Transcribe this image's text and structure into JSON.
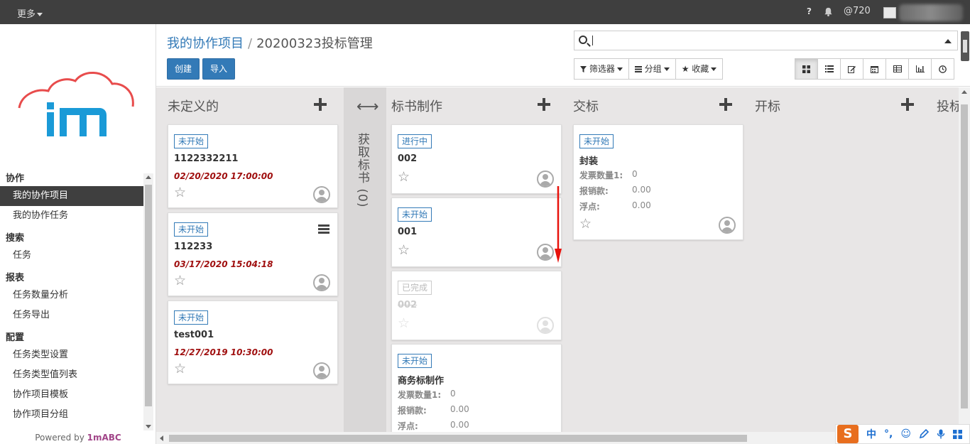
{
  "topbar": {
    "more": "更多",
    "help": "?",
    "at": "@720"
  },
  "sidebar": {
    "sections": [
      {
        "title": "协作",
        "items": [
          {
            "label": "我的协作项目",
            "active": true
          },
          {
            "label": "我的协作任务"
          }
        ]
      },
      {
        "title": "搜索",
        "items": [
          {
            "label": "任务"
          }
        ]
      },
      {
        "title": "报表",
        "items": [
          {
            "label": "任务数量分析"
          },
          {
            "label": "任务导出"
          }
        ]
      },
      {
        "title": "配置",
        "items": [
          {
            "label": "任务类型设置"
          },
          {
            "label": "任务类型值列表"
          },
          {
            "label": "协作项目模板"
          },
          {
            "label": "协作项目分组"
          }
        ]
      }
    ],
    "powered_prefix": "Powered by",
    "powered_brand": "1mABC"
  },
  "breadcrumb": {
    "parent": "我的协作项目",
    "sep": "/",
    "current": "20200323投标管理"
  },
  "buttons": {
    "create": "创建",
    "import": "导入"
  },
  "search": {
    "value": ""
  },
  "filters": {
    "filter": "筛选器",
    "group": "分组",
    "favorite": "收藏"
  },
  "views": [
    "kanban-icon",
    "list-icon",
    "form-icon",
    "calendar-icon",
    "pivot-icon",
    "graph-icon",
    "activity-icon"
  ],
  "columns": {
    "c1": {
      "title": "未定义的"
    },
    "folded": {
      "title": "获取标书 (0)"
    },
    "c2": {
      "title": "标书制作"
    },
    "c3": {
      "title": "交标"
    },
    "c4": {
      "title": "开标"
    },
    "c5": {
      "title": "投标"
    }
  },
  "cards": {
    "a1": {
      "tag": "未开始",
      "name": "1122332211",
      "date": "02/20/2020 17:00:00"
    },
    "a2": {
      "tag": "未开始",
      "name": "112233",
      "date": "03/17/2020 15:04:18"
    },
    "a3": {
      "tag": "未开始",
      "name": "test001",
      "date": "12/27/2019 10:30:00"
    },
    "b1": {
      "tag": "进行中",
      "name": "002"
    },
    "b2": {
      "tag": "未开始",
      "name": "001"
    },
    "b3": {
      "tag": "已完成",
      "name": "002"
    },
    "b4": {
      "tag": "未开始",
      "name": "商务标制作",
      "f1": "发票数量1:",
      "v1": "0",
      "f2": "报销款:",
      "v2": "0.00",
      "f3": "浮点:",
      "v3": "0.00"
    },
    "c1": {
      "tag": "未开始",
      "name": "封装",
      "f1": "发票数量1:",
      "v1": "0",
      "f2": "报销款:",
      "v2": "0.00",
      "f3": "浮点:",
      "v3": "0.00"
    }
  },
  "ime": {
    "logo": "S",
    "lang": "中",
    "punct": "°,"
  },
  "colors": {
    "primary": "#337ab7",
    "topbar": "#3f3f3f",
    "date_red": "#a01010",
    "arrow": "#e8120c"
  }
}
